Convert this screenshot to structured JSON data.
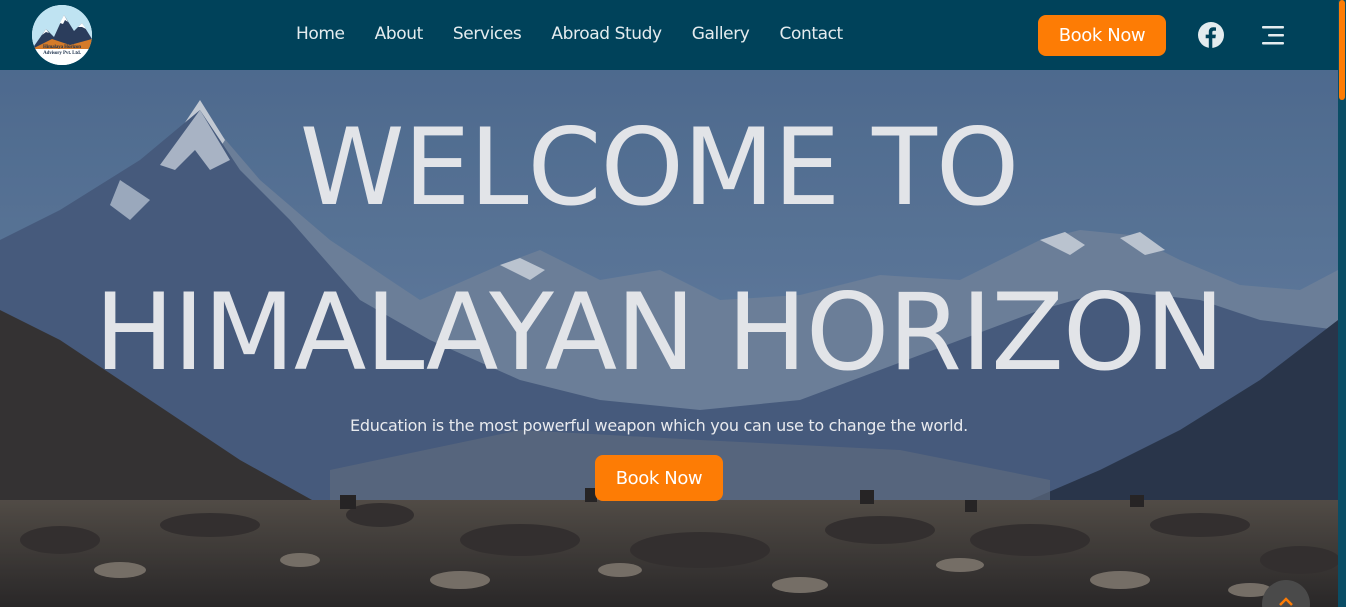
{
  "brand": {
    "logo_icon": "mountain-logo-icon",
    "logo_text_line1": "Himalaya Horizon",
    "logo_text_line2": "Advisory Pvt. Ltd."
  },
  "nav": {
    "items": [
      {
        "label": "Home"
      },
      {
        "label": "About"
      },
      {
        "label": "Services"
      },
      {
        "label": "Abroad Study"
      },
      {
        "label": "Gallery"
      },
      {
        "label": "Contact"
      }
    ],
    "book_label": "Book Now",
    "facebook_icon": "facebook-icon",
    "menu_icon": "menu-icon"
  },
  "hero": {
    "line1": "WELCOME TO",
    "line2": "HIMALAYAN HORIZON",
    "subtitle": "Education is the most powerful weapon which you can use to change the world.",
    "book_label": "Book Now",
    "background": "himalayan-mountains-photo",
    "scroll_top_icon": "chevron-up-icon"
  },
  "colors": {
    "navbar": "#00425a",
    "accent": "#fd7c05",
    "nav_text": "#e4ecef",
    "hero_text": "#e2e4e8"
  }
}
